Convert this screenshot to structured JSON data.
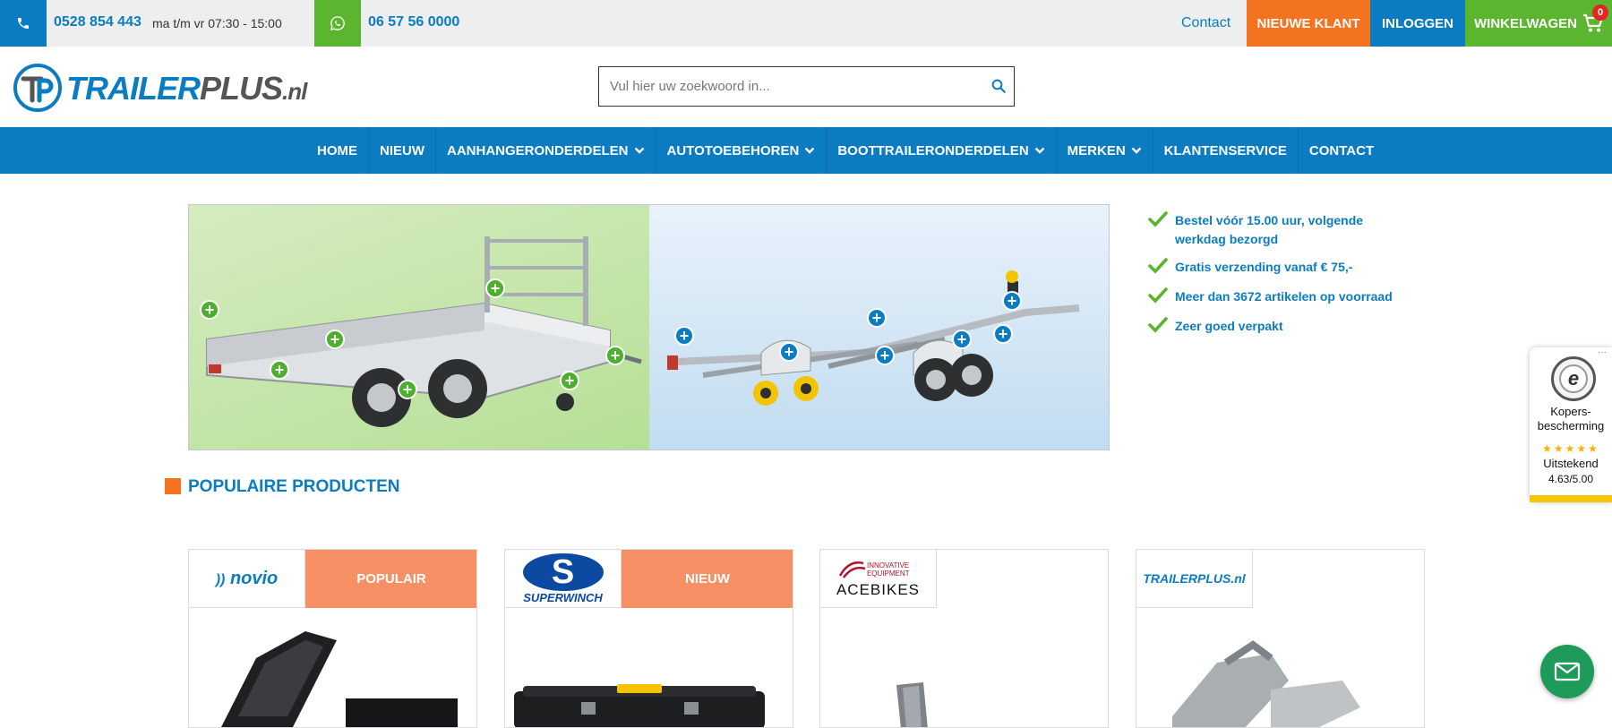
{
  "topbar": {
    "phone": "0528 854 443",
    "hours": "ma t/m vr 07:30 - 15:00",
    "whatsapp": "06 57 56 0000",
    "contact": "Contact",
    "new_customer": "NIEUWE KLANT",
    "login": "INLOGGEN",
    "cart": "WINKELWAGEN",
    "cart_count": "0"
  },
  "logo": {
    "part1": "TRAILER",
    "part2": "PLUS",
    "part3": ".nl"
  },
  "search": {
    "placeholder": "Vul hier uw zoekwoord in..."
  },
  "nav": {
    "items": [
      {
        "label": "HOME",
        "dropdown": false
      },
      {
        "label": "NIEUW",
        "dropdown": false
      },
      {
        "label": "AANHANGERONDERDELEN",
        "dropdown": true
      },
      {
        "label": "AUTOTOEBEHOREN",
        "dropdown": true
      },
      {
        "label": "BOOTTRAILERONDERDELEN",
        "dropdown": true
      },
      {
        "label": "MERKEN",
        "dropdown": true
      },
      {
        "label": "KLANTENSERVICE",
        "dropdown": false
      },
      {
        "label": "CONTACT",
        "dropdown": false
      }
    ]
  },
  "usp": [
    "Bestel vóór 15.00 uur, volgende werkdag bezorgd",
    "Gratis verzending vanaf € 75,-",
    "Meer dan 3672 artikelen op voorraad",
    "Zeer goed verpakt"
  ],
  "trusted": {
    "label": "Kopers-bescherming",
    "rating": "Uitstekend",
    "score": "4.63/5.00",
    "rating_value": 4.63,
    "rating_max": 5
  },
  "section": {
    "title": "POPULAIRE PRODUCTEN"
  },
  "products": [
    {
      "brand": "novio",
      "badge": "POPULAIR"
    },
    {
      "brand": "SUPERWINCH",
      "badge": "NIEUW"
    },
    {
      "brand": "ACEBIKES",
      "brand_sub": "INNOVATIVE EQUIPMENT",
      "badge": ""
    },
    {
      "brand": "TRAILERPLUS.nl",
      "badge": ""
    }
  ],
  "colors": {
    "primary": "#0b7cc1",
    "green": "#5bb52f",
    "orange": "#f47321",
    "badge": "#f89066"
  },
  "icons": {
    "phone": "phone-icon",
    "whatsapp": "whatsapp-icon",
    "cart": "cart-icon",
    "search": "search-icon",
    "check": "check-icon",
    "chat": "mail-chat-icon"
  }
}
